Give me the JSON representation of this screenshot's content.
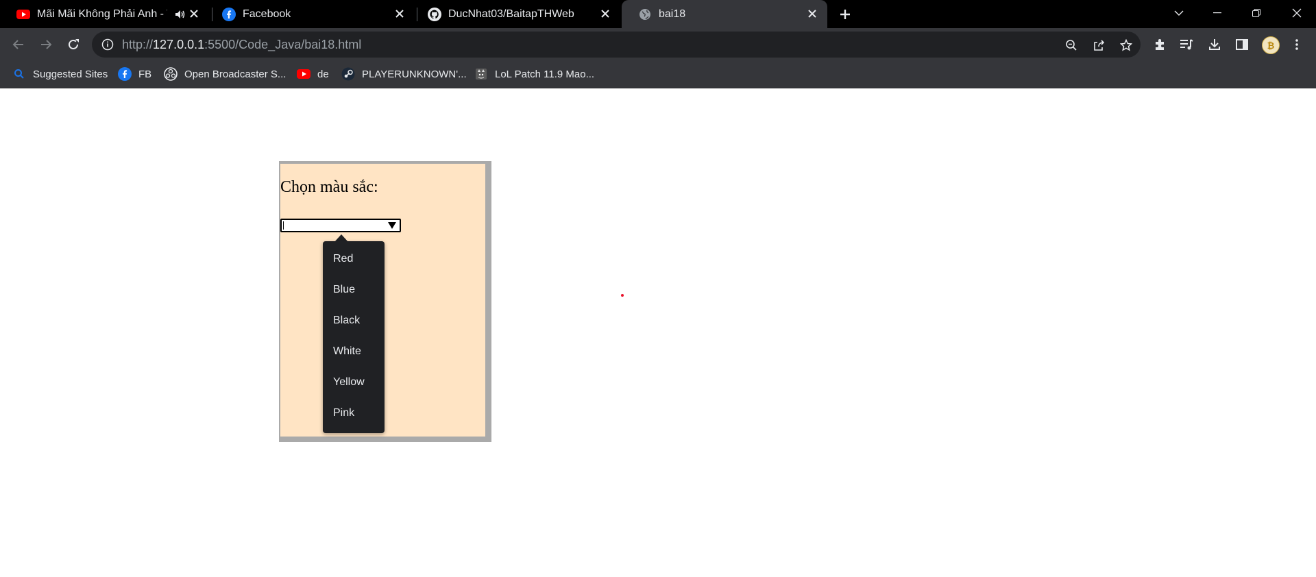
{
  "browser": {
    "tabs": [
      {
        "title": "Mãi Mãi Không Phải Anh - Th",
        "favicon": "youtube-icon",
        "audio": true
      },
      {
        "title": "Facebook",
        "favicon": "facebook-icon"
      },
      {
        "title": "DucNhat03/BaitapTHWeb",
        "favicon": "github-icon"
      },
      {
        "title": "bai18",
        "favicon": "globe-icon",
        "active": true
      }
    ],
    "url": {
      "scheme": "http://",
      "host": "127.0.0.1",
      "rest": ":5500/Code_Java/bai18.html"
    },
    "bookmarks": [
      {
        "label": "Suggested Sites",
        "icon": "search-icon"
      },
      {
        "label": "FB",
        "icon": "facebook-icon"
      },
      {
        "label": "Open Broadcaster S...",
        "icon": "obs-icon"
      },
      {
        "label": "de",
        "icon": "youtube-icon"
      },
      {
        "label": "PLAYERUNKNOWN'...",
        "icon": "steam-icon"
      },
      {
        "label": "LoL Patch 11.9 Mao...",
        "icon": "cat-icon"
      }
    ]
  },
  "page": {
    "label": "Chọn màu sắc:",
    "select_value": "",
    "options": [
      "Red",
      "Blue",
      "Black",
      "White",
      "Yellow",
      "Pink"
    ],
    "panel_bg": "#ffe4c4",
    "panel_border": "#aaaaaa"
  },
  "colors": {
    "tabstrip": "#000000",
    "toolbar": "#35363a",
    "omnibox": "#202124",
    "dropdown": "#202124",
    "youtube_red": "#ff0000",
    "facebook_blue": "#1877f2"
  }
}
